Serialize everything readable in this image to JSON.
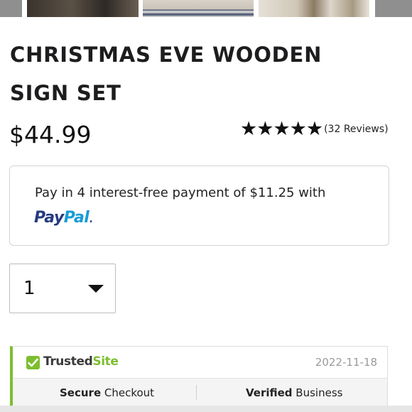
{
  "gallery": {
    "thumbnail_count": 5
  },
  "product": {
    "title": "CHRISTMAS EVE WOODEN SIGN SET",
    "price": "$44.99",
    "rating": {
      "stars": 5,
      "max": 5,
      "reviews_text": "(32 Reviews)"
    }
  },
  "paypal": {
    "message": "Pay in 4 interest-free payment of $11.25 with",
    "logo_part1": "Pay",
    "logo_part2": "Pal",
    "logo_suffix": ".",
    "colors": {
      "dark": "#253b80",
      "light": "#179bd7"
    }
  },
  "quantity": {
    "selected": "1"
  },
  "trustedsite": {
    "brand_part1": "Trusted",
    "brand_part2": "Site",
    "date": "2022-11-18",
    "cell1_bold": "Secure",
    "cell1_rest": " Checkout",
    "cell2_bold": "Verified",
    "cell2_rest": " Business",
    "accent": "#7dbe2e"
  },
  "icons": {
    "check": "check-icon",
    "caret": "chevron-down-icon",
    "star": "star-icon"
  }
}
